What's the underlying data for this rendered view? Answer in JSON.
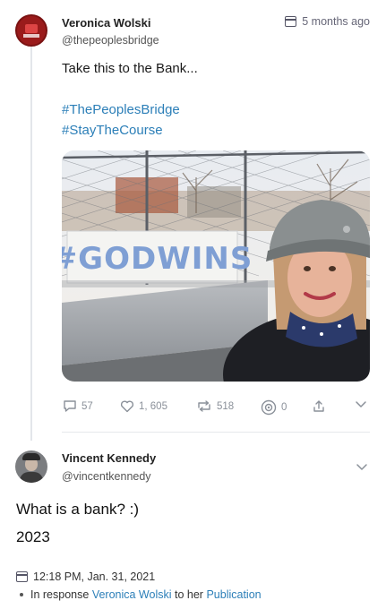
{
  "post": {
    "author_name": "Veronica Wolski",
    "author_handle": "@thepeoplesbridge",
    "timestamp": "5 months ago",
    "text": "Take this to the Bank...",
    "hashtags": [
      "#ThePeoplesBridge",
      "#StayTheCourse"
    ],
    "banner_text": "#GODWINS",
    "actions": {
      "comments": "57",
      "likes": "1, 605",
      "reposts": "518",
      "views": "0"
    }
  },
  "reply": {
    "author_name": "Vincent Kennedy",
    "author_handle": "@vincentkennedy",
    "line1": "What is a bank? :)",
    "line2": "2023",
    "date": "12:18 PM, Jan. 31, 2021",
    "response_prefix": "In response",
    "response_user": "Veronica Wolski",
    "response_mid": "to her",
    "response_link": "Publication"
  },
  "colors": {
    "link": "#2c7fb8",
    "muted": "#8a9099"
  }
}
